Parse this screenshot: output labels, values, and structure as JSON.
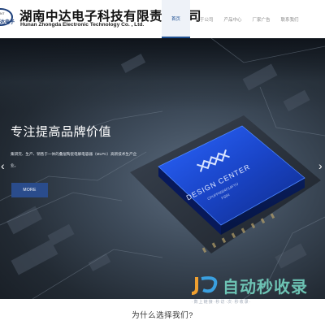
{
  "header": {
    "logo_en_fragment": "NT",
    "logo_cn_fragment": "达电子",
    "company_cn": "湖南中达电子科技有限责任公司",
    "company_en": "Hunan Zhongda Electronic Technology Co. , Ltd."
  },
  "nav": {
    "items": [
      {
        "label": "首页",
        "active": true
      },
      {
        "label": "关于公司",
        "active": false
      },
      {
        "label": "产品中心",
        "active": false
      },
      {
        "label": "厂家广告",
        "active": false
      },
      {
        "label": "联系我们",
        "active": false
      }
    ]
  },
  "hero": {
    "title": "专注提高品牌价值",
    "description": "集研究、生产、销售于一体的叠层陶瓷电解电容器（MLPC）高新技术生产企业。",
    "more_label": "MORE",
    "chip": {
      "line1": "DESIGN CENTER",
      "line2": "CPUFP0004F14FYU",
      "line3": "FS64"
    },
    "accent_color": "#1f4fd0"
  },
  "watermark": {
    "title": "自动秒收录",
    "subtitle": "·数上链接·秒访·次·秒收录·"
  },
  "section": {
    "title": "为什么选择我们?"
  }
}
